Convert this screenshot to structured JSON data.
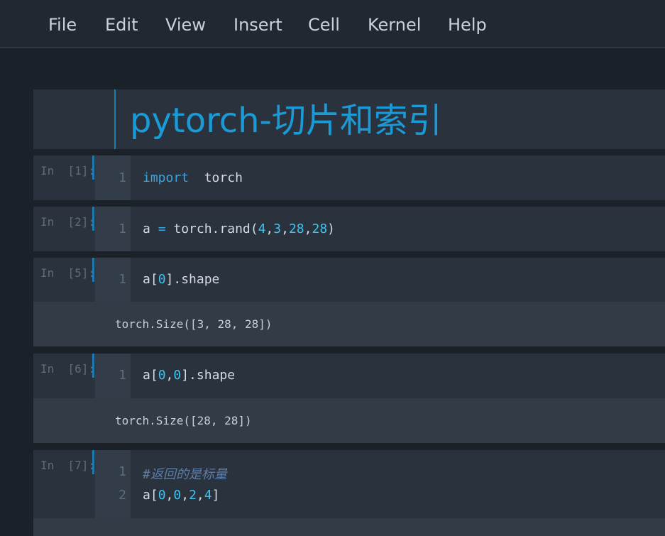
{
  "menu": [
    "File",
    "Edit",
    "View",
    "Insert",
    "Cell",
    "Kernel",
    "Help"
  ],
  "title": "pytorch-切片和索引",
  "cells": [
    {
      "prompt": "In  [1]:",
      "lines": [
        {
          "n": "1",
          "code": "import  torch"
        }
      ]
    },
    {
      "prompt": "In  [2]:",
      "lines": [
        {
          "n": "1",
          "code": "a = torch.rand(4,3,28,28)"
        }
      ]
    },
    {
      "prompt": "In  [5]:",
      "lines": [
        {
          "n": "1",
          "code": "a[0].shape"
        }
      ],
      "output": "torch.Size([3, 28, 28])"
    },
    {
      "prompt": "In  [6]:",
      "lines": [
        {
          "n": "1",
          "code": "a[0,0].shape"
        }
      ],
      "output": "torch.Size([28, 28])"
    },
    {
      "prompt": "In  [7]:",
      "lines": [
        {
          "n": "1",
          "code": "#返回的是标量"
        },
        {
          "n": "2",
          "code": "a[0,0,2,4]"
        }
      ]
    }
  ],
  "colors": {
    "accent": "#1a9bd7",
    "keyword": "#3aa6e0",
    "number": "#3ec3f0",
    "comment": "#5e7ea9"
  }
}
